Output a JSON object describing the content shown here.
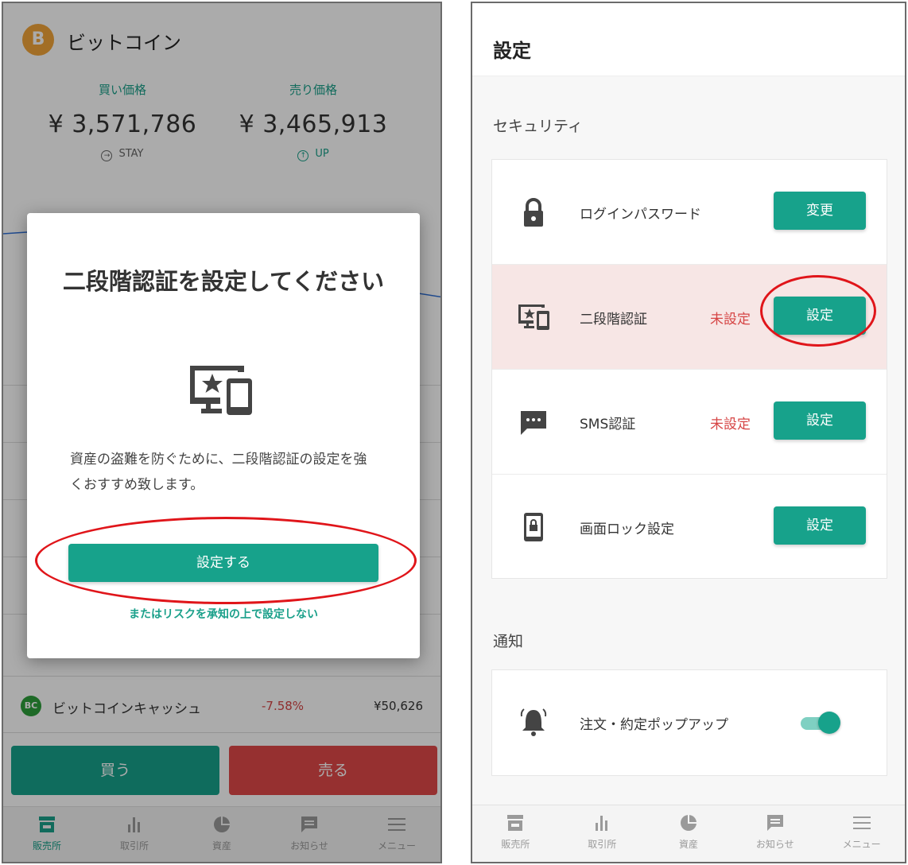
{
  "left": {
    "coin": {
      "logo": "B",
      "name": "ビットコイン"
    },
    "buy": {
      "label": "買い価格",
      "value": "¥ 3,571,786",
      "status": "STAY"
    },
    "sell": {
      "label": "売り価格",
      "value": "¥ 3,465,913",
      "status": "UP"
    },
    "bch_row": {
      "logo": "BC",
      "name": "ビットコインキャッシュ",
      "change": "-7.58%",
      "price": "¥50,626"
    },
    "buy_button": "買う",
    "sell_button": "売る",
    "modal": {
      "title": "二段階認証を設定してください",
      "icon": "monitor-star-phone-icon",
      "body": "資産の盗難を防ぐために、二段階認証の設定を強くおすすめ致します。",
      "primary": "設定する",
      "secondary": "またはリスクを承知の上で設定しない"
    },
    "nav": [
      {
        "label": "販売所",
        "icon": "store-icon"
      },
      {
        "label": "取引所",
        "icon": "bar-chart-icon"
      },
      {
        "label": "資産",
        "icon": "pie-chart-icon"
      },
      {
        "label": "お知らせ",
        "icon": "message-icon"
      },
      {
        "label": "メニュー",
        "icon": "menu-icon"
      }
    ]
  },
  "right": {
    "title": "設定",
    "security": {
      "title": "セキュリティ",
      "rows": [
        {
          "icon": "lock-icon",
          "label": "ログインパスワード",
          "status": "",
          "button": "変更"
        },
        {
          "icon": "monitor-star-phone-icon",
          "label": "二段階認証",
          "status": "未設定",
          "button": "設定"
        },
        {
          "icon": "chat-icon",
          "label": "SMS認証",
          "status": "未設定",
          "button": "設定"
        },
        {
          "icon": "phone-lock-icon",
          "label": "画面ロック設定",
          "status": "",
          "button": "設定"
        }
      ]
    },
    "notify": {
      "title": "通知",
      "row": {
        "icon": "bell-icon",
        "label": "注文・約定ポップアップ",
        "toggle_on": true
      }
    },
    "nav": [
      {
        "label": "販売所",
        "icon": "store-icon"
      },
      {
        "label": "取引所",
        "icon": "bar-chart-icon"
      },
      {
        "label": "資産",
        "icon": "pie-chart-icon"
      },
      {
        "label": "お知らせ",
        "icon": "message-icon"
      },
      {
        "label": "メニュー",
        "icon": "menu-icon"
      }
    ]
  },
  "colors": {
    "accent": "#17a28b",
    "sell": "#e04848",
    "highlight": "#f7e6e5",
    "annotation": "#e0151a"
  }
}
